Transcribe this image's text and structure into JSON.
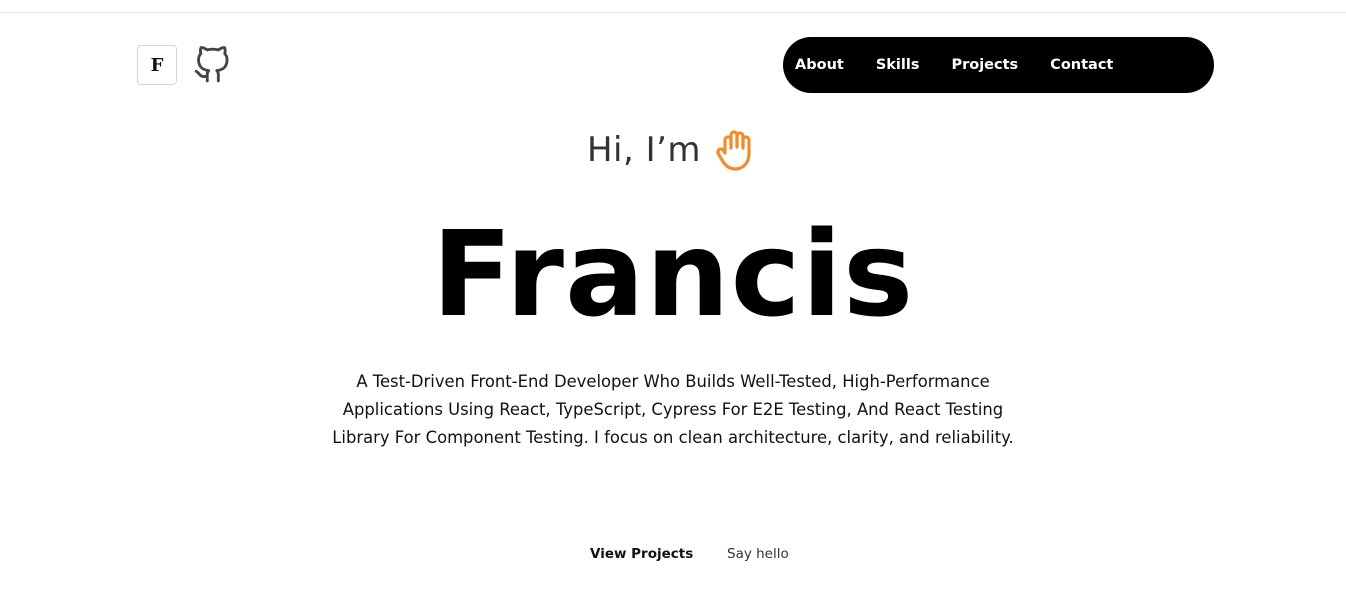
{
  "header": {
    "logo_letter": "F",
    "github_icon": "github-icon"
  },
  "nav": {
    "items": [
      {
        "label": "About"
      },
      {
        "label": "Skills"
      },
      {
        "label": "Projects"
      },
      {
        "label": "Contact"
      }
    ]
  },
  "hero": {
    "greeting": "Hi, I’m",
    "greeting_icon": "waving-hand-icon",
    "name": "Francis",
    "description": "A Test-Driven Front-End Developer Who Builds Well-Tested, High-Performance Applications Using React, TypeScript, Cypress For E2E Testing, And React Testing Library For Component Testing. I focus on clean architecture, clarity, and reliability.",
    "primary_cta": "View Projects",
    "secondary_cta": "Say hello"
  },
  "colors": {
    "nav_bg": "#000000",
    "hand_accent": "#f28c28",
    "text": "#111111"
  }
}
